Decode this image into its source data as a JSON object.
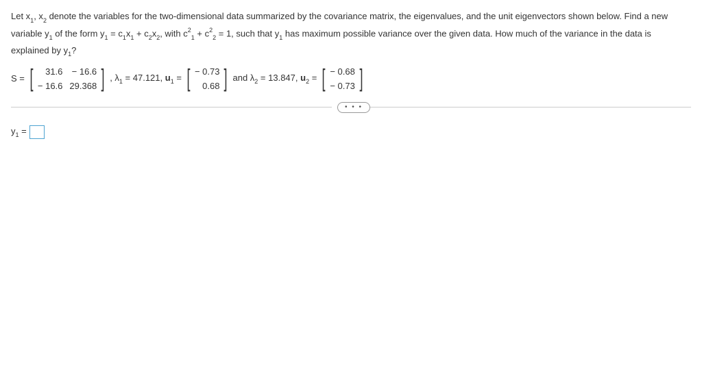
{
  "problem": {
    "intro_part1": "Let x",
    "intro_part2": ", x",
    "intro_part3": " denote the variables for the two-dimensional data summarized by the covariance matrix, the eigenvalues, and the unit eigenvectors shown below. Find a new variable y",
    "intro_part4": " of the form y",
    "intro_part5": " = c",
    "intro_part6": "x",
    "intro_part7": " + c",
    "intro_part8": "x",
    "intro_part9": ", with c",
    "intro_part10": " + c",
    "intro_part11": " = 1, such that y",
    "intro_part12": " has maximum possible variance over the given data. How much of the variance in the data is explained by y",
    "intro_part13": "?",
    "sub1": "1",
    "sub2": "2",
    "sup2": "2"
  },
  "matrix_line": {
    "s_label": "S =",
    "S": {
      "r1c1": "31.6",
      "r1c2": "− 16.6",
      "r2c1": "− 16.6",
      "r2c2": "29.368"
    },
    "comma": ", ",
    "lambda1_label": "λ",
    "lambda1_value": " = 47.121, ",
    "u1_label": "u",
    "equals": " = ",
    "u1": {
      "r1": "− 0.73",
      "r2": "0.68"
    },
    "and": " and ",
    "lambda2_label": "λ",
    "lambda2_value": " = 13.847, ",
    "u2_label": "u",
    "u2": {
      "r1": "− 0.68",
      "r2": "− 0.73"
    }
  },
  "dots": "• • •",
  "answer": {
    "y1_prefix": "y",
    "y1_eq": " = "
  }
}
